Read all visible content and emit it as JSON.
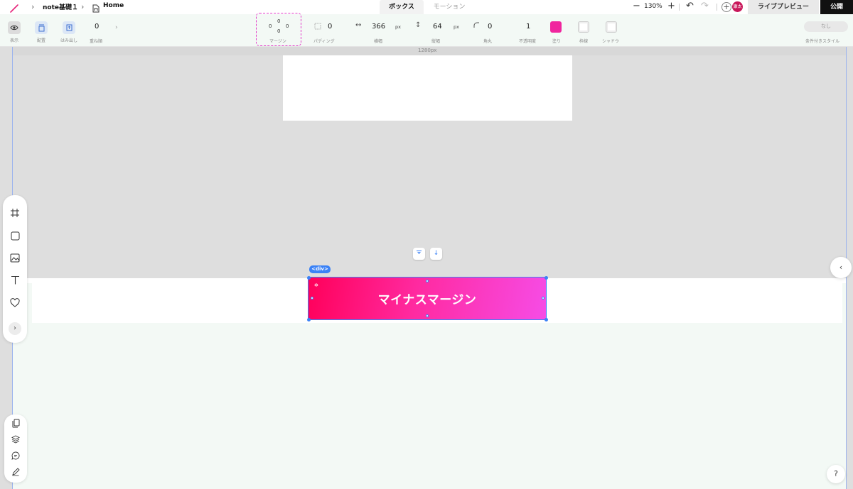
{
  "topbar": {
    "breadcrumb": [
      "note基礎１",
      "Home"
    ],
    "tabs": [
      {
        "label": "ボックス",
        "active": true
      },
      {
        "label": "モーション",
        "active": false
      }
    ],
    "zoom": "130%",
    "zoom_out_glyph": "−",
    "zoom_in_glyph": "+",
    "avatar_text": "康太",
    "live_preview_label": "ライブプレビュー",
    "publish_label": "公開"
  },
  "propbar": {
    "view_label": "表示",
    "arrange_label": "配置",
    "overflow_label": "はみ出し",
    "zindex_value": "0",
    "zindex_label": "重ね順",
    "margin": {
      "top": "0",
      "left": "0",
      "right": "0",
      "bottom": "0",
      "label": "マージン"
    },
    "padding": {
      "value": "0",
      "label": "パディング"
    },
    "width": {
      "value": "366",
      "unit": "px",
      "label": "横幅"
    },
    "height": {
      "value": "64",
      "unit": "px",
      "label": "縦幅"
    },
    "radius": {
      "value": "0",
      "label": "角丸"
    },
    "opacity": {
      "value": "1",
      "label": "不透明度"
    },
    "fill_label": "塗り",
    "fill_color": "#f0259e",
    "border_label": "枠線",
    "shadow_label": "シャドウ",
    "conditional_value": "なし",
    "conditional_label": "条件付きスタイル"
  },
  "canvas": {
    "ruler_label": "1280px",
    "div_tag": "<div>",
    "box_text": "マイナスマージン",
    "accent_color": "#3b82f6"
  },
  "help_label": "?"
}
